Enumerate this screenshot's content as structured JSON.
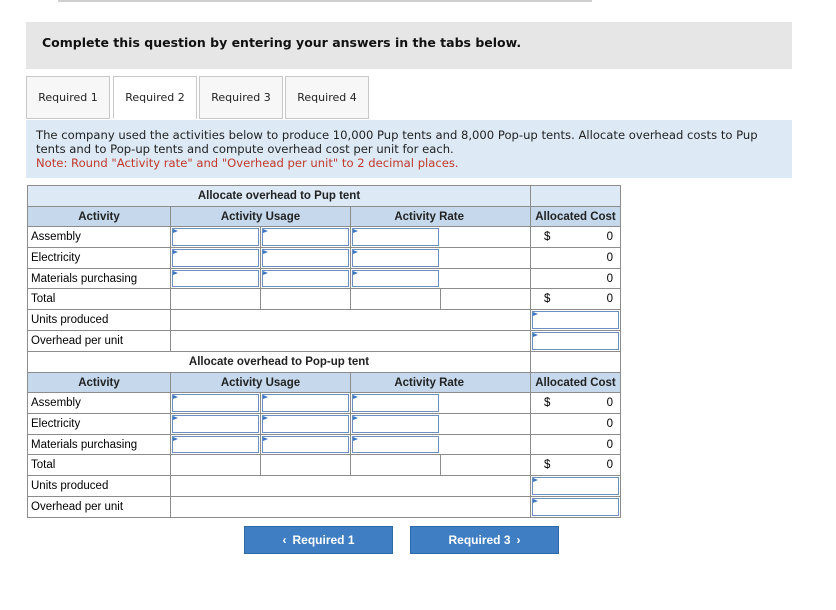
{
  "banner": {
    "title": "Complete this question by entering your answers in the tabs below."
  },
  "tabs": [
    {
      "label": "Required 1"
    },
    {
      "label": "Required 2"
    },
    {
      "label": "Required 3"
    },
    {
      "label": "Required 4"
    }
  ],
  "active_tab": "Required 2",
  "instructions": {
    "text": "The company used the activities below to produce 10,000 Pup tents and 8,000 Pop-up tents. Allocate overhead costs to Pup tents and to Pop-up tents and compute overhead cost per unit for each.",
    "note": "Note: Round \"Activity rate\" and \"Overhead per unit\" to 2 decimal places."
  },
  "pup": {
    "title": "Allocate overhead to Pup tent",
    "headers": {
      "activity": "Activity",
      "usage": "Activity Usage",
      "rate": "Activity Rate",
      "cost": "Allocated Cost"
    },
    "rows": [
      {
        "label": "Assembly",
        "symbol": "$",
        "cost": "0"
      },
      {
        "label": "Electricity",
        "cost": "0"
      },
      {
        "label": "Materials purchasing",
        "cost": "0"
      }
    ],
    "total": {
      "label": "Total",
      "symbol": "$",
      "cost": "0"
    },
    "units_label": "Units produced",
    "per_unit_label": "Overhead per unit"
  },
  "popup": {
    "title": "Allocate overhead to Pop-up tent",
    "headers": {
      "activity": "Activity",
      "usage": "Activity Usage",
      "rate": "Activity Rate",
      "cost": "Allocated Cost"
    },
    "rows": [
      {
        "label": "Assembly",
        "symbol": "$",
        "cost": "0"
      },
      {
        "label": "Electricity",
        "cost": "0"
      },
      {
        "label": "Materials purchasing",
        "cost": "0"
      }
    ],
    "total": {
      "label": "Total",
      "symbol": "$",
      "cost": "0"
    },
    "units_label": "Units produced",
    "per_unit_label": "Overhead per unit"
  },
  "nav": {
    "prev_label": "Required 1",
    "next_label": "Required 3",
    "prev_icon": "chevron-left-icon",
    "next_icon": "chevron-right-icon"
  },
  "colors": {
    "header_bg": "#c5d8ec",
    "instruction_bg": "#ddeaf6",
    "button_bg": "#3f7ec2",
    "note_color": "#c0392b"
  }
}
